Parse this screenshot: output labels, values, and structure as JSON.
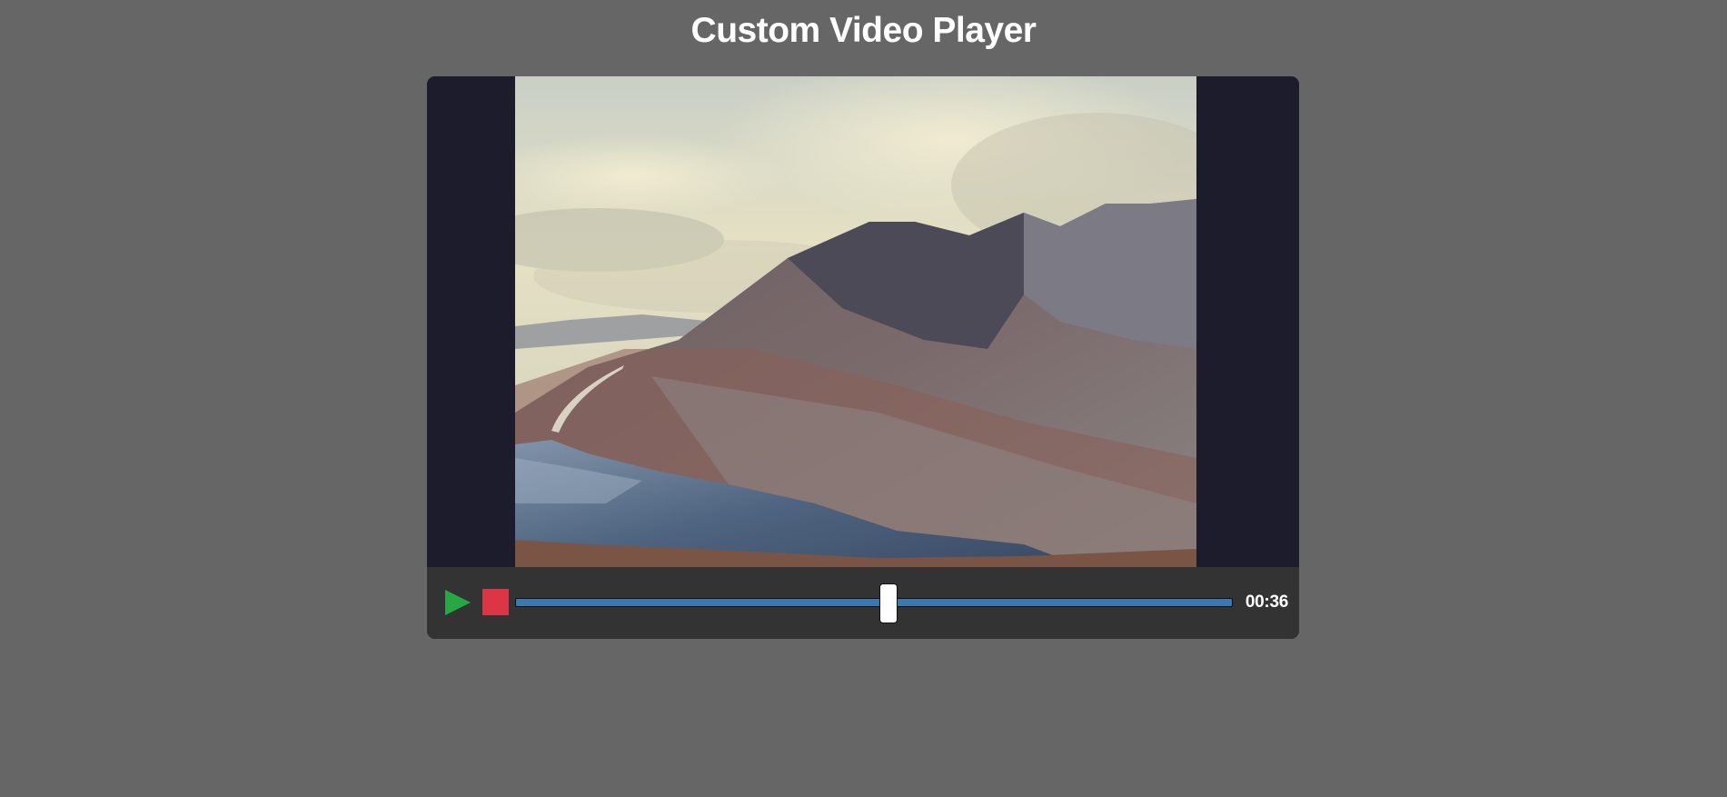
{
  "page": {
    "title": "Custom Video Player"
  },
  "player": {
    "video_description_icon": "mountain-lake-landscape-frame",
    "controls": {
      "play_icon": "play-icon",
      "stop_icon": "stop-icon",
      "progress_fraction": 0.52,
      "time": "00:36"
    }
  },
  "colors": {
    "background": "#666666",
    "player_bg": "#1c1c2c",
    "controls_bg": "#333333",
    "play": "#28a745",
    "stop": "#dc3545",
    "progress": "#3a78b0"
  }
}
